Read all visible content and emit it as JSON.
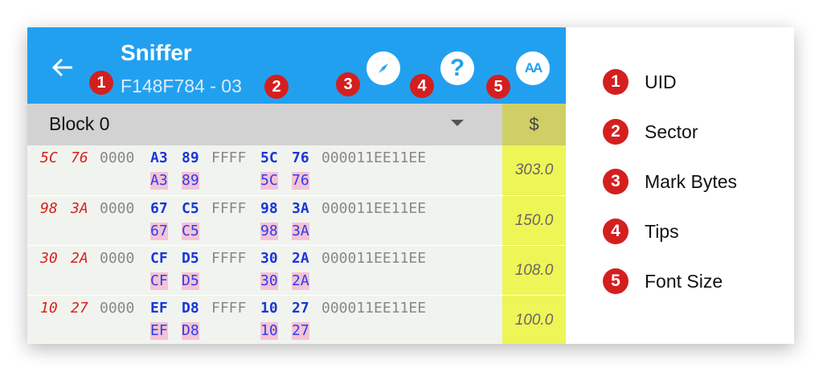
{
  "appbar": {
    "title": "Sniffer",
    "subtitle": "F148F784 - 03",
    "color": "#22a0f0"
  },
  "actions": [
    {
      "icon": "compass-icon"
    },
    {
      "icon": "help-icon",
      "glyph": "?"
    },
    {
      "icon": "font-size-icon",
      "glyph": "AA"
    }
  ],
  "badges": [
    "1",
    "2",
    "3",
    "4",
    "5"
  ],
  "block": {
    "label": "Block 0",
    "value_header": "$"
  },
  "rows": [
    {
      "uid": [
        "5C",
        "76"
      ],
      "c1": "0000",
      "m": [
        "A3",
        "89"
      ],
      "c2": "FFFF",
      "n": [
        "5C",
        "76"
      ],
      "tail": "000011EE11EE",
      "sub1": [
        "A3",
        "89"
      ],
      "sub2": [
        "5C",
        "76"
      ],
      "value": "303.0"
    },
    {
      "uid": [
        "98",
        "3A"
      ],
      "c1": "0000",
      "m": [
        "67",
        "C5"
      ],
      "c2": "FFFF",
      "n": [
        "98",
        "3A"
      ],
      "tail": "000011EE11EE",
      "sub1": [
        "67",
        "C5"
      ],
      "sub2": [
        "98",
        "3A"
      ],
      "value": "150.0"
    },
    {
      "uid": [
        "30",
        "2A"
      ],
      "c1": "0000",
      "m": [
        "CF",
        "D5"
      ],
      "c2": "FFFF",
      "n": [
        "30",
        "2A"
      ],
      "tail": "000011EE11EE",
      "sub1": [
        "CF",
        "D5"
      ],
      "sub2": [
        "30",
        "2A"
      ],
      "value": "108.0"
    },
    {
      "uid": [
        "10",
        "27"
      ],
      "c1": "0000",
      "m": [
        "EF",
        "D8"
      ],
      "c2": "FFFF",
      "n": [
        "10",
        "27"
      ],
      "tail": "000011EE11EE",
      "sub1": [
        "EF",
        "D8"
      ],
      "sub2": [
        "10",
        "27"
      ],
      "value": "100.0"
    }
  ],
  "legend": [
    {
      "num": "1",
      "label": "UID"
    },
    {
      "num": "2",
      "label": "Sector"
    },
    {
      "num": "3",
      "label": "Mark Bytes"
    },
    {
      "num": "4",
      "label": "Tips"
    },
    {
      "num": "5",
      "label": "Font Size"
    }
  ]
}
